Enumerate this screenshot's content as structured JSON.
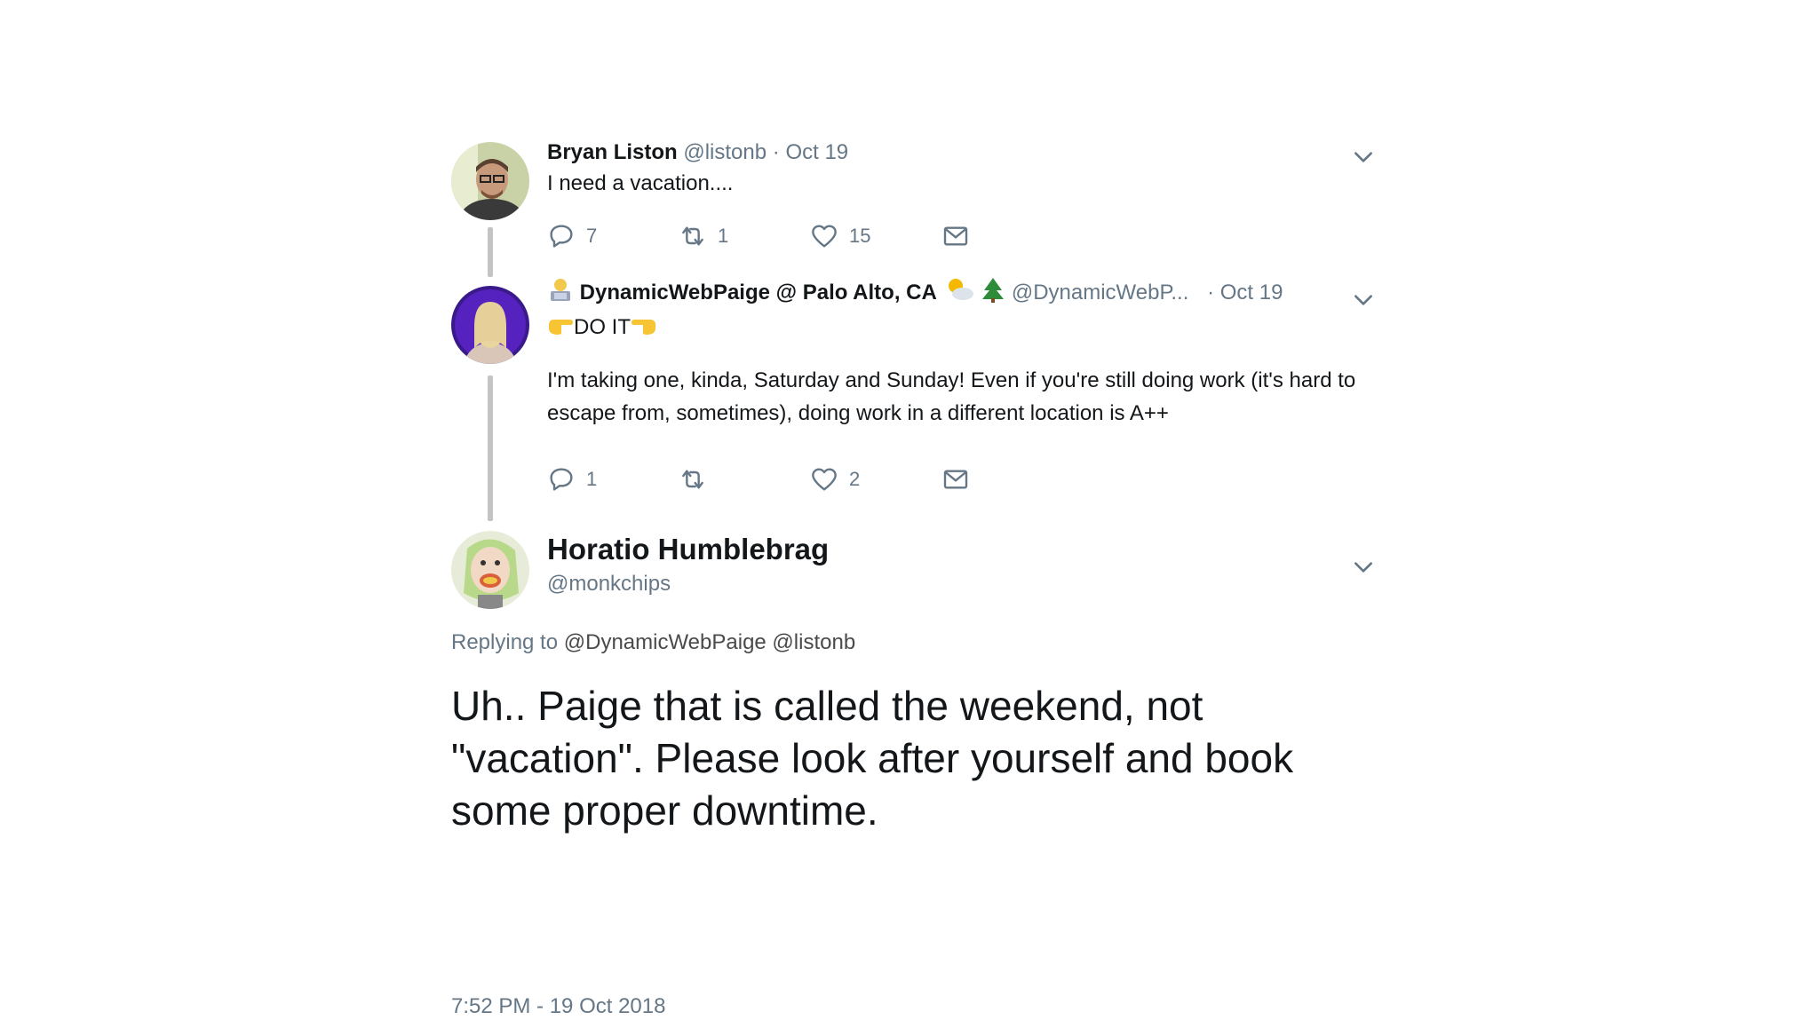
{
  "tweet1": {
    "name": "Bryan Liston",
    "handle": "@listonb",
    "date": "· Oct 19",
    "text": "I need a vacation....",
    "replies": "7",
    "retweets": "1",
    "likes": "15"
  },
  "tweet2": {
    "name": "DynamicWebPaige @ Palo Alto, CA",
    "handle": "@DynamicWebP...",
    "date": "· Oct 19",
    "text_line1": "DO IT",
    "text_para": "I'm taking one, kinda, Saturday and Sunday! Even if you're still doing work (it's hard to escape from, sometimes), doing work in a different location is A++",
    "replies": "1",
    "retweets": "",
    "likes": "2"
  },
  "tweet3": {
    "name": "Horatio Humblebrag",
    "handle": "@monkchips",
    "replying_label": "Replying to",
    "replying_to": "@DynamicWebPaige @listonb",
    "text": "Uh.. Paige that is called the weekend, not \"vacation\". Please look after yourself and book some proper downtime.",
    "timestamp": "7:52 PM - 19 Oct 2018"
  },
  "icons": {
    "reply": "reply-icon",
    "retweet": "retweet-icon",
    "like": "heart-icon",
    "dm": "mail-icon",
    "caret": "chevron-down-icon"
  },
  "colors": {
    "text": "#14171a",
    "muted": "#657786",
    "connector": "#c4c4c4"
  }
}
